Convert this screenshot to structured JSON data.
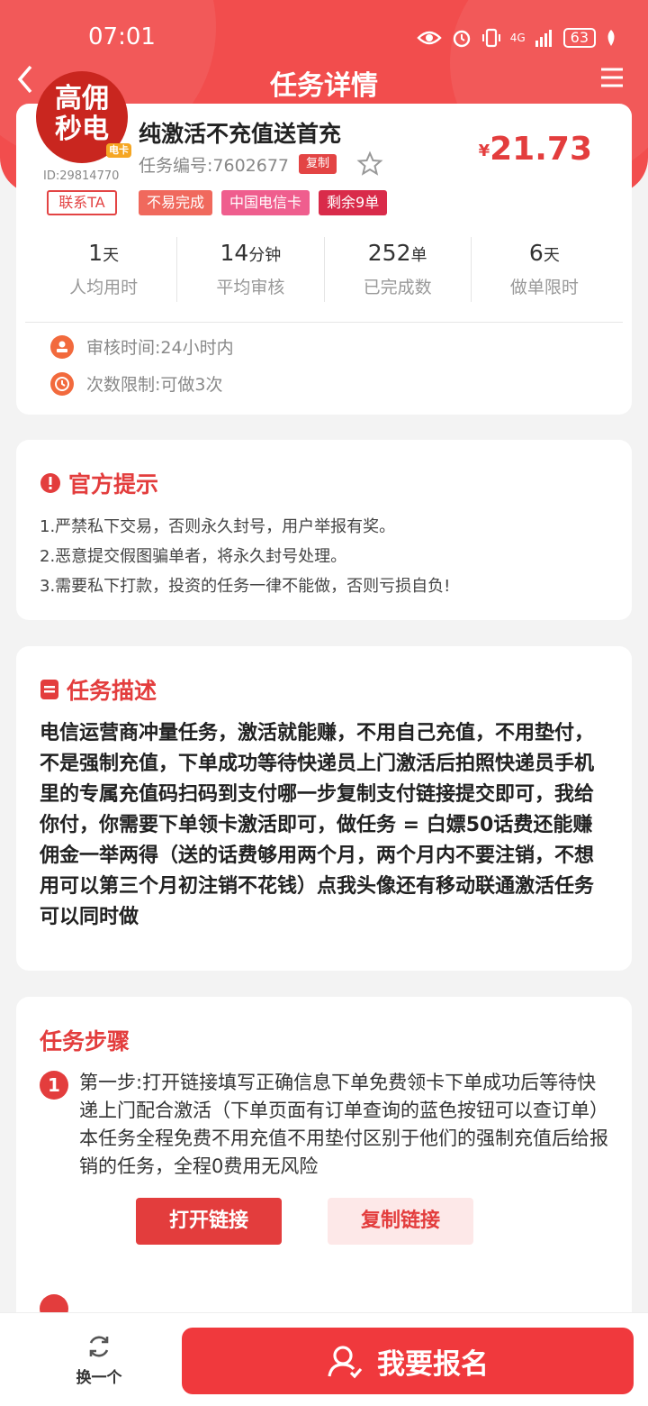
{
  "status_bar": {
    "time": "07:01",
    "network": "4G",
    "battery": "63"
  },
  "header": {
    "title": "任务详情"
  },
  "task": {
    "avatar_text_line1": "高佣",
    "avatar_text_line2": "秒电",
    "avatar_tag": "电卡",
    "user_id": "ID:29814770",
    "contact_label": "联系TA",
    "title": "纯激活不充值送首充",
    "task_number": "任务编号:7602677",
    "copy_label": "复制",
    "price_currency": "¥",
    "price": "21.73",
    "badges": [
      "不易完成",
      "中国电信卡",
      "剩余9单"
    ],
    "stats": [
      {
        "value": "1",
        "unit": "天",
        "label": "人均用时"
      },
      {
        "value": "14",
        "unit": "分钟",
        "label": "平均审核"
      },
      {
        "value": "252",
        "unit": "单",
        "label": "已完成数"
      },
      {
        "value": "6",
        "unit": "天",
        "label": "做单限时"
      }
    ],
    "review_time": "审核时间:24小时内",
    "times_limit": "次数限制:可做3次"
  },
  "notice": {
    "title": "官方提示",
    "items": [
      "1.严禁私下交易，否则永久封号，用户举报有奖。",
      "2.恶意提交假图骗单者，将永久封号处理。",
      "3.需要私下打款，投资的任务一律不能做，否则亏损自负!"
    ]
  },
  "description": {
    "title": "任务描述",
    "text": "电信运营商冲量任务，激活就能赚，不用自己充值，不用垫付，不是强制充值，下单成功等待快递员上门激活后拍照快递员手机里的专属充值码扫码到支付哪一步复制支付链接提交即可，我给你付，你需要下单领卡激活即可，做任务 = 白嫖50话费还能赚佣金一举两得（送的话费够用两个月，两个月内不要注销，不想用可以第三个月初注销不花钱）点我头像还有移动联通激活任务可以同时做"
  },
  "steps": {
    "title": "任务步骤",
    "items": [
      {
        "num": "1",
        "text": "第一步:打开链接填写正确信息下单免费领卡下单成功后等待快递上门配合激活（下单页面有订单查询的蓝色按钮可以查订单）本任务全程免费不用充值不用垫付区别于他们的强制充值后给报销的任务，全程0费用无风险"
      }
    ],
    "open_link_label": "打开链接",
    "copy_link_label": "复制链接"
  },
  "bottom": {
    "switch_label": "换一个",
    "apply_label": "我要报名"
  },
  "colors": {
    "primary": "#f24d4d",
    "price": "#e33d3d"
  }
}
